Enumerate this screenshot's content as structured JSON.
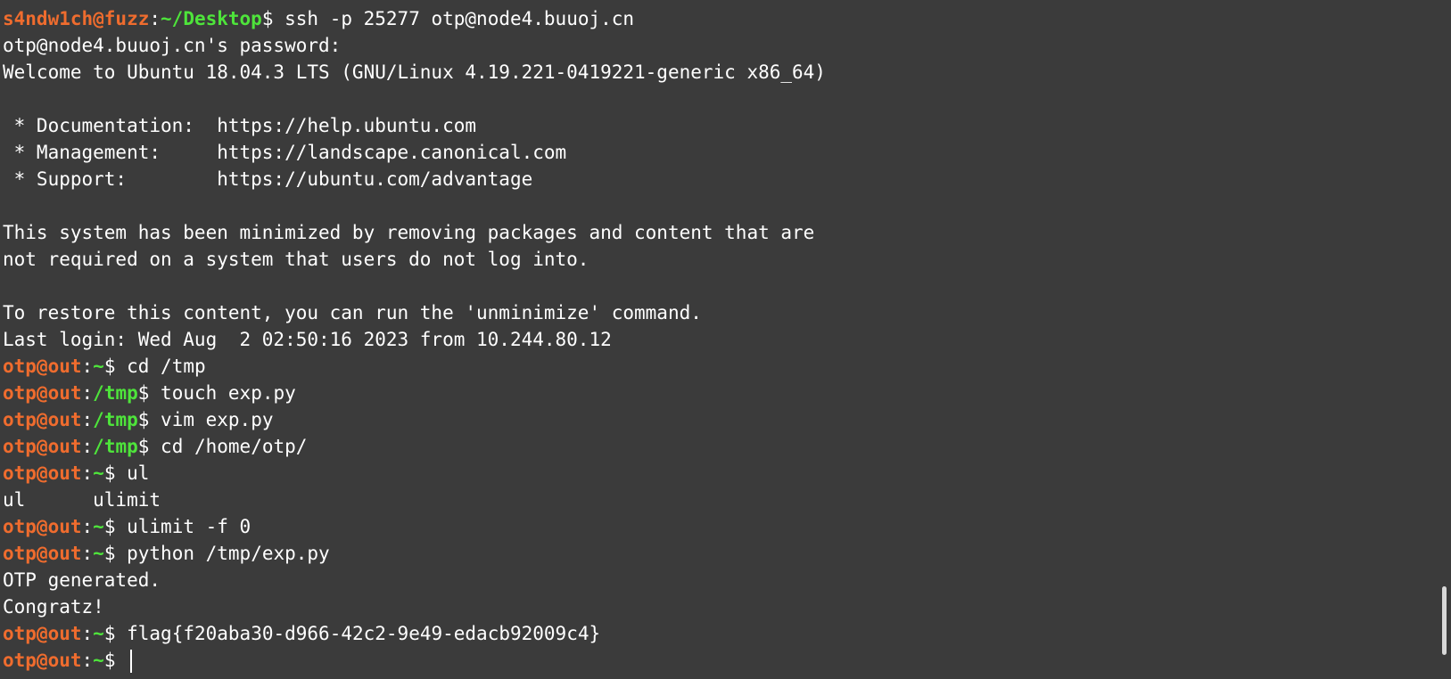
{
  "terminal": {
    "lines": [
      {
        "type": "prompt",
        "user": "s4ndw1ch@fuzz",
        "path": "~/Desktop",
        "command": "ssh -p 25277 otp@node4.buuoj.cn"
      },
      {
        "type": "text",
        "text": "otp@node4.buuoj.cn's password: "
      },
      {
        "type": "text",
        "text": "Welcome to Ubuntu 18.04.3 LTS (GNU/Linux 4.19.221-0419221-generic x86_64)"
      },
      {
        "type": "text",
        "text": ""
      },
      {
        "type": "text",
        "text": " * Documentation:  https://help.ubuntu.com"
      },
      {
        "type": "text",
        "text": " * Management:     https://landscape.canonical.com"
      },
      {
        "type": "text",
        "text": " * Support:        https://ubuntu.com/advantage"
      },
      {
        "type": "text",
        "text": ""
      },
      {
        "type": "text",
        "text": "This system has been minimized by removing packages and content that are"
      },
      {
        "type": "text",
        "text": "not required on a system that users do not log into."
      },
      {
        "type": "text",
        "text": ""
      },
      {
        "type": "text",
        "text": "To restore this content, you can run the 'unminimize' command."
      },
      {
        "type": "text",
        "text": "Last login: Wed Aug  2 02:50:16 2023 from 10.244.80.12"
      },
      {
        "type": "prompt",
        "user": "otp@out",
        "path": "~",
        "command": "cd /tmp"
      },
      {
        "type": "prompt",
        "user": "otp@out",
        "path": "/tmp",
        "command": "touch exp.py"
      },
      {
        "type": "prompt",
        "user": "otp@out",
        "path": "/tmp",
        "command": "vim exp.py"
      },
      {
        "type": "prompt",
        "user": "otp@out",
        "path": "/tmp",
        "command": "cd /home/otp/"
      },
      {
        "type": "prompt",
        "user": "otp@out",
        "path": "~",
        "command": "ul"
      },
      {
        "type": "text",
        "text": "ul      ulimit"
      },
      {
        "type": "prompt",
        "user": "otp@out",
        "path": "~",
        "command": "ulimit -f 0"
      },
      {
        "type": "prompt",
        "user": "otp@out",
        "path": "~",
        "command": "python /tmp/exp.py"
      },
      {
        "type": "text",
        "text": "OTP generated."
      },
      {
        "type": "text",
        "text": "Congratz!"
      },
      {
        "type": "prompt",
        "user": "otp@out",
        "path": "~",
        "command": "flag{f20aba30-d966-42c2-9e49-edacb92009c4}"
      },
      {
        "type": "prompt",
        "user": "otp@out",
        "path": "~",
        "command": "",
        "cursor": true
      }
    ],
    "scrollbar": {
      "position": 0.96,
      "visible_fraction": 0.1
    }
  },
  "colors": {
    "background": "#3b3b3b",
    "text": "#ffffff",
    "prompt_user": "#ef6c2e",
    "prompt_path": "#4ee43b"
  }
}
